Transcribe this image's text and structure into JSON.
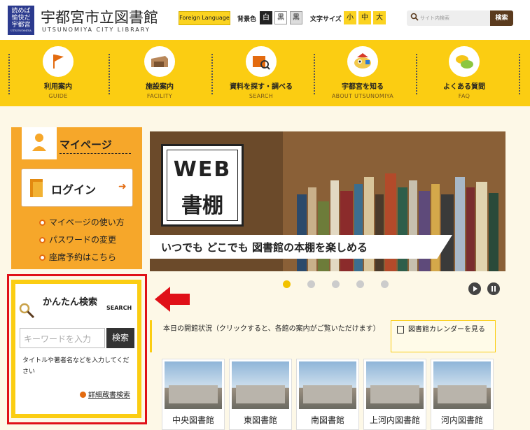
{
  "header": {
    "logo_mark": "読めば愉快だ宇都宮",
    "logo_mark_sub": "UTSUNOMIYA",
    "title": "宇都宮市立図書館",
    "subtitle": "UTSUNOMIYA CITY LIBRARY",
    "foreign_language": "Foreign Language",
    "bg_color_label": "背景色",
    "bg_options": [
      "白",
      "黒",
      "黒"
    ],
    "font_size_label": "文字サイズ",
    "font_sizes": [
      "小",
      "中",
      "大"
    ],
    "search_placeholder": "サイト内検索",
    "search_button": "検索"
  },
  "nav": [
    {
      "label": "利用案内",
      "sub": "GUIDE",
      "icon": "flag-icon"
    },
    {
      "label": "施設案内",
      "sub": "FACILITY",
      "icon": "building-icon"
    },
    {
      "label": "資料を探す・調べる",
      "sub": "SEARCH",
      "icon": "book-search-icon"
    },
    {
      "label": "宇都宮を知る",
      "sub": "ABOUT UTSUNOMIYA",
      "icon": "mascot-icon"
    },
    {
      "label": "よくある質問",
      "sub": "FAQ",
      "icon": "speech-bubble-icon"
    }
  ],
  "mypage": {
    "title": "マイページ",
    "login": "ログイン",
    "links": [
      "マイページの使い方",
      "パスワードの変更",
      "座席予約はこちら"
    ]
  },
  "easy_search": {
    "title": "かんたん検索",
    "title_en": "SEARCH",
    "placeholder": "キーワードを入力",
    "button": "検索",
    "note": "タイトルや著者名などを入力してください",
    "advanced": "詳細蔵書検索"
  },
  "banner": {
    "line1": "WEB",
    "line2": "書棚",
    "ribbon": "いつでも どこでも 図書館の本棚を楽しめる"
  },
  "status": {
    "text": "本日の開館状況（クリックすると、各館の案内がご覧いただけます）",
    "calendar": "図書館カレンダーを見る"
  },
  "branches": [
    "中央図書館",
    "東図書館",
    "南図書館",
    "上河内図書館",
    "河内図書館"
  ],
  "colors": {
    "accent_yellow": "#fbcd12",
    "mypage_orange": "#f6a72a",
    "highlight_red": "#e01018",
    "dark_button": "#5b3b1e"
  }
}
